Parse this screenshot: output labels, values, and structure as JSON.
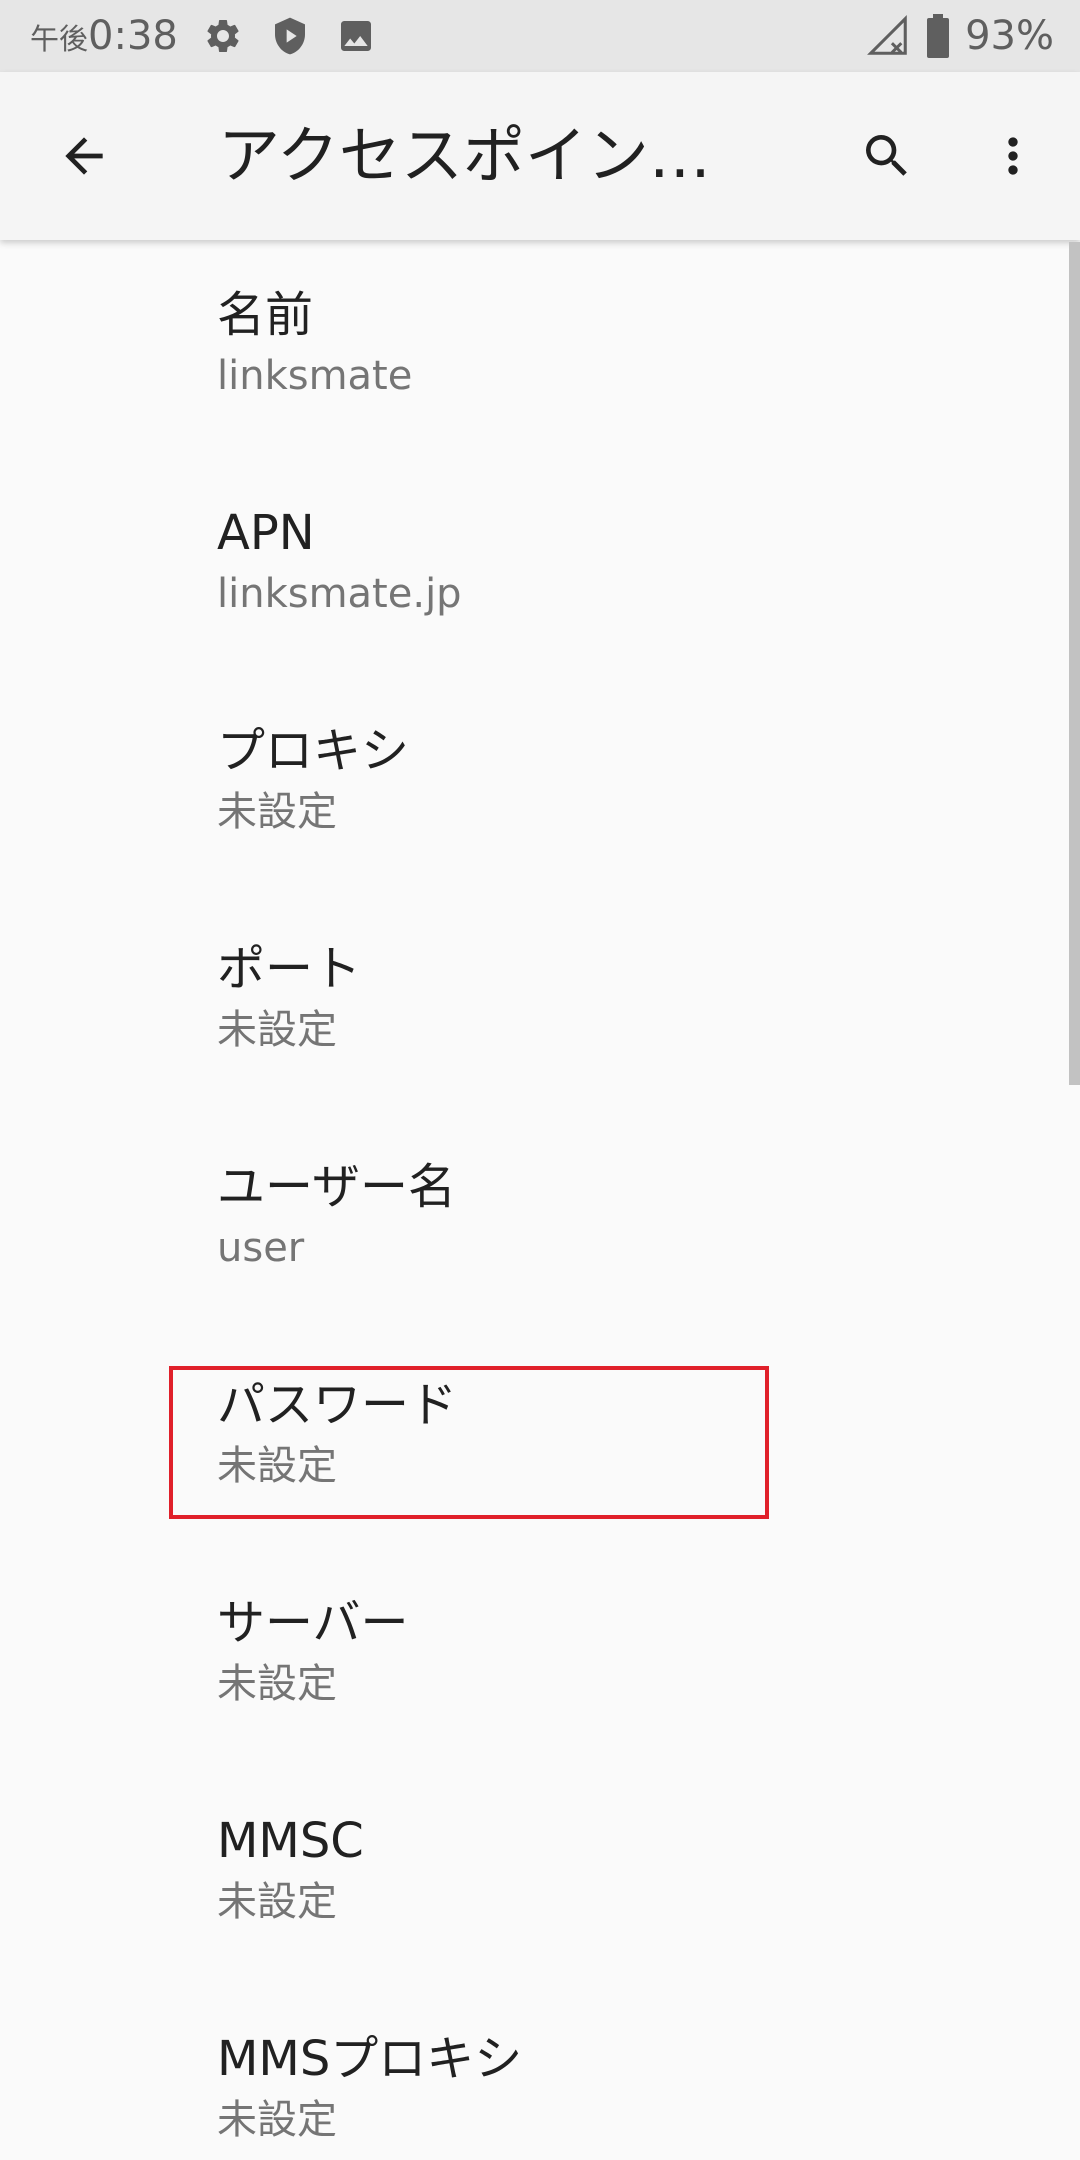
{
  "status_bar": {
    "time_prefix": "午後",
    "time": "0:38",
    "battery": "93%",
    "icons": [
      "settings-icon",
      "shield-play-icon",
      "image-icon",
      "no-signal-icon",
      "battery-icon"
    ]
  },
  "app_bar": {
    "title": "アクセスポイント…",
    "back_icon": "arrow-back-icon",
    "search_icon": "search-icon",
    "more_icon": "more-vert-icon"
  },
  "preferences": [
    {
      "title": "名前",
      "summary": "linksmate"
    },
    {
      "title": "APN",
      "summary": "linksmate.jp"
    },
    {
      "title": "プロキシ",
      "summary": "未設定"
    },
    {
      "title": "ポート",
      "summary": "未設定"
    },
    {
      "title": "ユーザー名",
      "summary": "user"
    },
    {
      "title": "パスワード",
      "summary": "未設定"
    },
    {
      "title": "サーバー",
      "summary": "未設定"
    },
    {
      "title": "MMSC",
      "summary": "未設定"
    },
    {
      "title": "MMSプロキシ",
      "summary": "未設定"
    }
  ],
  "colors": {
    "highlight": "#e0202a",
    "status_bar_bg": "#e6e6e6",
    "app_bar_bg": "#f5f5f5",
    "background": "#fafafa"
  }
}
